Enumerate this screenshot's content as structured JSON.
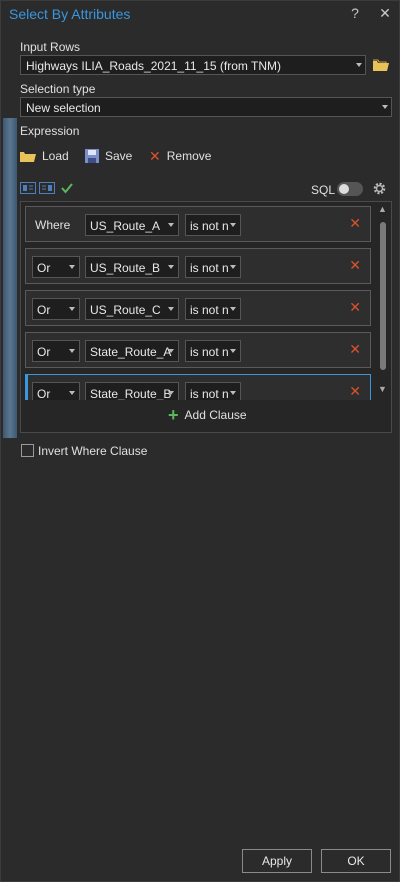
{
  "window": {
    "title": "Select By Attributes",
    "help": "?",
    "close": "✕"
  },
  "input_rows": {
    "label": "Input Rows",
    "value": "Highways ILIA_Roads_2021_11_15 (from TNM)"
  },
  "selection_type": {
    "label": "Selection type",
    "value": "New selection"
  },
  "expression": {
    "label": "Expression"
  },
  "toolbar": {
    "load": "Load",
    "save": "Save",
    "remove": "Remove",
    "sql": "SQL"
  },
  "clauses": [
    {
      "connector": "Where",
      "field": "US_Route_A",
      "operator": "is not n"
    },
    {
      "connector": "Or",
      "field": "US_Route_B",
      "operator": "is not n"
    },
    {
      "connector": "Or",
      "field": "US_Route_C",
      "operator": "is not n"
    },
    {
      "connector": "Or",
      "field": "State_Route_A",
      "operator": "is not n"
    },
    {
      "connector": "Or",
      "field": "State_Route_B",
      "operator": "is not n"
    }
  ],
  "add_clause": "Add Clause",
  "invert": {
    "label": "Invert Where Clause",
    "checked": false
  },
  "buttons": {
    "apply": "Apply",
    "ok": "OK"
  },
  "colors": {
    "accent": "#3a96dd",
    "delete": "#d9532b",
    "add": "#5cb85c"
  }
}
